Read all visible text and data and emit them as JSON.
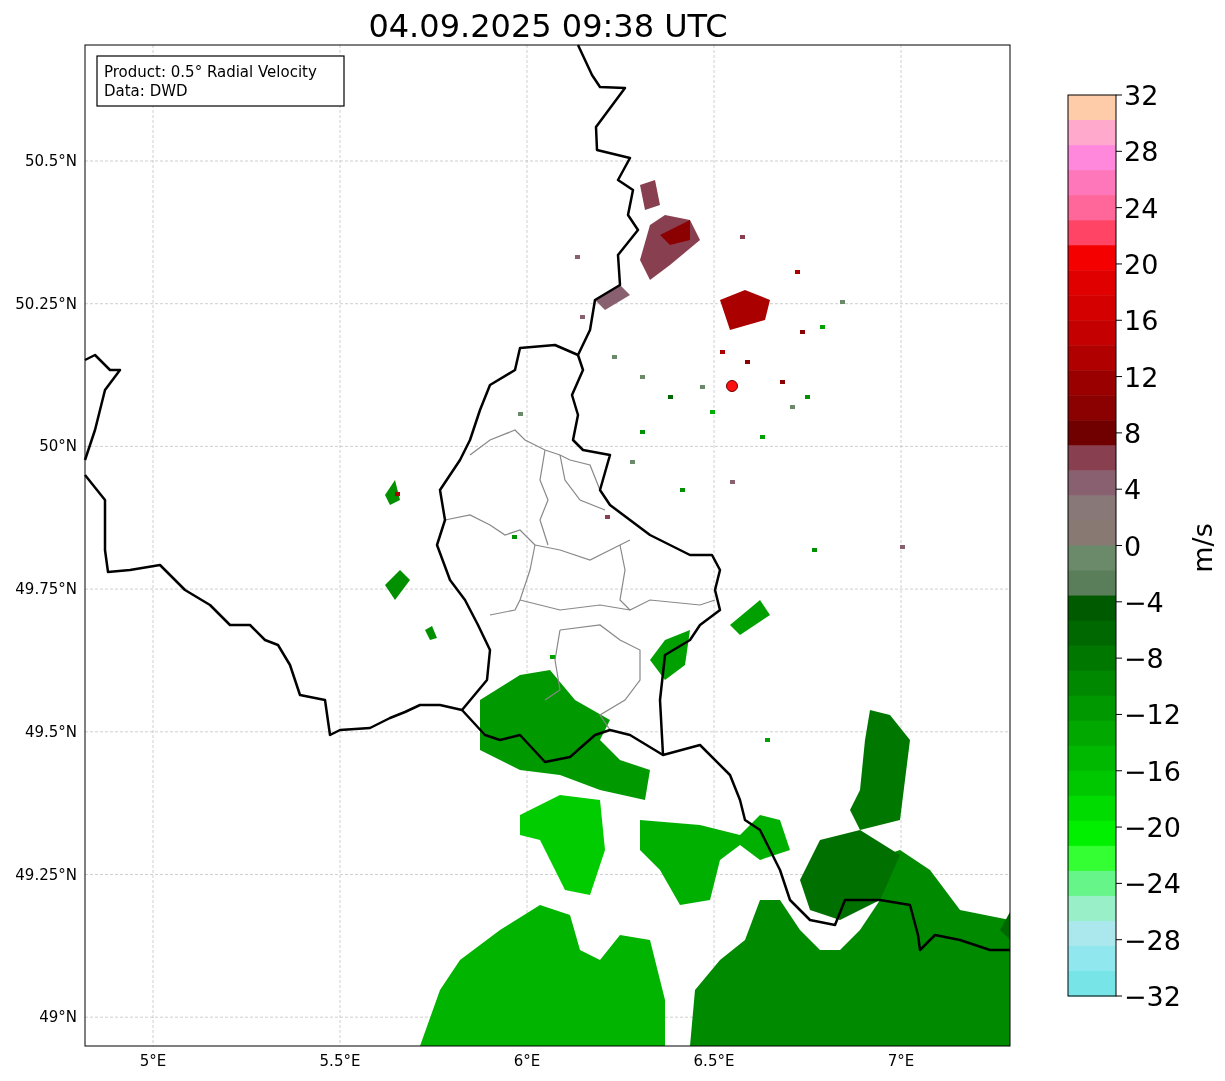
{
  "title": "04.09.2025 09:38 UTC",
  "info_box": [
    "Product: 0.5° Radial Velocity",
    "Data: DWD"
  ],
  "map": {
    "lat_labels": [
      "50.5°N",
      "50.25°N",
      "50°N",
      "49.75°N",
      "49.5°N",
      "49.25°N",
      "49°N"
    ],
    "lon_labels": [
      "5°E",
      "5.5°E",
      "6°E",
      "6.5°E",
      "7°E"
    ]
  },
  "colorbar": {
    "label": "m/s",
    "ticks": [
      "32",
      "28",
      "24",
      "20",
      "16",
      "12",
      "8",
      "4",
      "0",
      "−4",
      "−8",
      "−12",
      "−16",
      "−20",
      "−24",
      "−28",
      "−32"
    ],
    "bands": [
      {
        "color": "#ffccaa"
      },
      {
        "color": "#ffaacc"
      },
      {
        "color": "#ff88dd"
      },
      {
        "color": "#ff77bb"
      },
      {
        "color": "#ff6699"
      },
      {
        "color": "#ff4466"
      },
      {
        "color": "#f50000"
      },
      {
        "color": "#e00000"
      },
      {
        "color": "#d40000"
      },
      {
        "color": "#c40000"
      },
      {
        "color": "#b00000"
      },
      {
        "color": "#9a0000"
      },
      {
        "color": "#8b0000"
      },
      {
        "color": "#700000"
      },
      {
        "color": "#884050"
      },
      {
        "color": "#886070"
      },
      {
        "color": "#887878"
      },
      {
        "color": "#887a72"
      },
      {
        "color": "#6a8a6a"
      },
      {
        "color": "#5a7e5a"
      },
      {
        "color": "#005a00"
      },
      {
        "color": "#006800"
      },
      {
        "color": "#007800"
      },
      {
        "color": "#008800"
      },
      {
        "color": "#009800"
      },
      {
        "color": "#00a800"
      },
      {
        "color": "#00b800"
      },
      {
        "color": "#00c800"
      },
      {
        "color": "#00dc00"
      },
      {
        "color": "#00f000"
      },
      {
        "color": "#33ff33"
      },
      {
        "color": "#66f588"
      },
      {
        "color": "#99f0c8"
      },
      {
        "color": "#aae8ee"
      },
      {
        "color": "#90e8ee"
      },
      {
        "color": "#77e4e8"
      }
    ]
  }
}
